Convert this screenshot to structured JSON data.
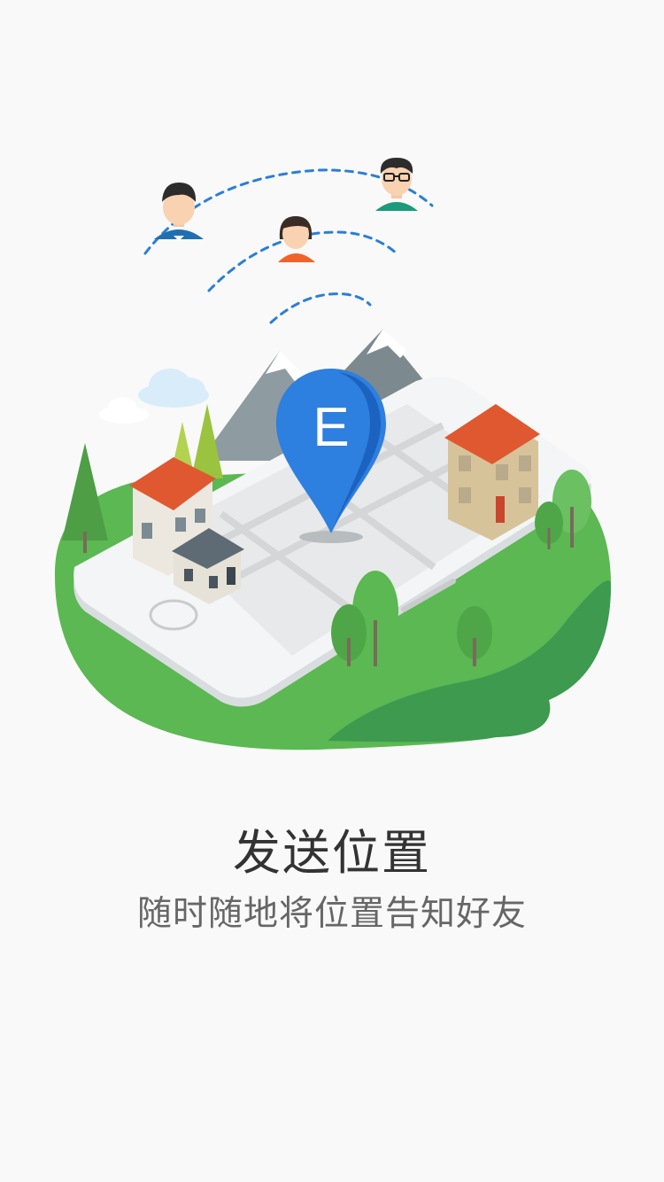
{
  "screen": {
    "title": "发送位置",
    "subtitle": "随时随地将位置告知好友"
  },
  "illustration": {
    "pin_letter": "E",
    "colors": {
      "background": "#f9f9f9",
      "pin_blue": "#2d7fe0",
      "grass_light": "#5bb852",
      "grass_dark": "#3d9a4e",
      "roof": "#e0582f",
      "signal_dash": "#2a7fd6"
    },
    "icons": [
      "user-avatar-boy-icon",
      "user-avatar-girl-icon",
      "user-avatar-glasses-icon",
      "location-pin-icon",
      "phone-icon",
      "house-icon",
      "tree-icon",
      "mountain-icon",
      "cloud-icon"
    ]
  }
}
